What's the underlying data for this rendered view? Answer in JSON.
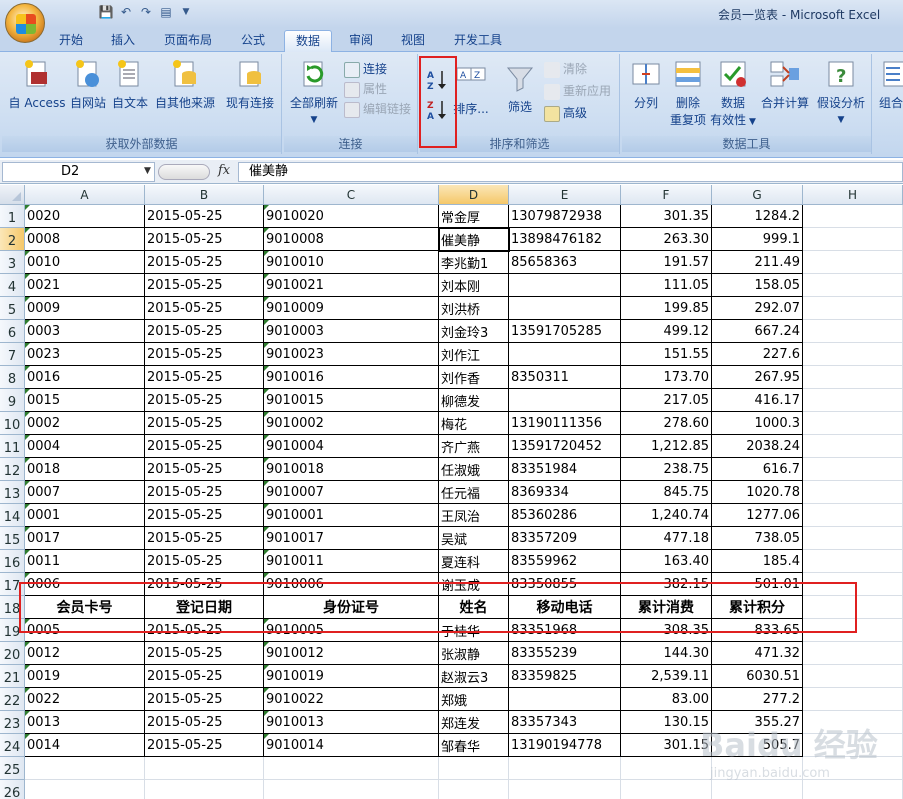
{
  "window": {
    "title": "会员一览表 - Microsoft Excel"
  },
  "tabs": [
    "开始",
    "插入",
    "页面布局",
    "公式",
    "数据",
    "审阅",
    "视图",
    "开发工具"
  ],
  "active_tab": "数据",
  "ribbon": {
    "group_external": {
      "label": "获取外部数据",
      "buttons": [
        "自 Access",
        "自网站",
        "自文本",
        "自其他来源",
        "现有连接"
      ]
    },
    "group_connections": {
      "label": "连接",
      "refresh": "全部刷新",
      "connections": "连接",
      "properties": "属性",
      "edit_links": "编辑链接"
    },
    "group_sort_filter": {
      "label": "排序和筛选",
      "sort": "排序...",
      "filter": "筛选",
      "clear": "清除",
      "reapply": "重新应用",
      "advanced": "高级"
    },
    "group_data_tools": {
      "label": "数据工具",
      "split": "分列",
      "remove_dup_1": "删除",
      "remove_dup_2": "重复项",
      "validation_1": "数据",
      "validation_2": "有效性",
      "consolidate": "合并计算",
      "whatif": "假设分析"
    },
    "group_outline": {
      "label": "组合"
    }
  },
  "formula_bar": {
    "name_box": "D2",
    "fx": "fx",
    "content": "催美静"
  },
  "columns": [
    "A",
    "B",
    "C",
    "D",
    "E",
    "F",
    "G",
    "H"
  ],
  "header_row": [
    "会员卡号",
    "登记日期",
    "身份证号",
    "姓名",
    "移动电话",
    "累计消费",
    "累计积分"
  ],
  "rows": [
    {
      "n": "1",
      "a": "0020",
      "b": "2015-05-25",
      "c": "9010020",
      "d": "常金厚",
      "e": "13079872938",
      "f": "301.35",
      "g": "1284.2"
    },
    {
      "n": "2",
      "a": "0008",
      "b": "2015-05-25",
      "c": "9010008",
      "d": "催美静",
      "e": "13898476182",
      "f": "263.30",
      "g": "999.1"
    },
    {
      "n": "3",
      "a": "0010",
      "b": "2015-05-25",
      "c": "9010010",
      "d": "李兆勤1",
      "e": "85658363",
      "f": "191.57",
      "g": "211.49"
    },
    {
      "n": "4",
      "a": "0021",
      "b": "2015-05-25",
      "c": "9010021",
      "d": "刘本刚",
      "e": "",
      "f": "111.05",
      "g": "158.05"
    },
    {
      "n": "5",
      "a": "0009",
      "b": "2015-05-25",
      "c": "9010009",
      "d": "刘洪桥",
      "e": "",
      "f": "199.85",
      "g": "292.07"
    },
    {
      "n": "6",
      "a": "0003",
      "b": "2015-05-25",
      "c": "9010003",
      "d": "刘金玲3",
      "e": "13591705285",
      "f": "499.12",
      "g": "667.24"
    },
    {
      "n": "7",
      "a": "0023",
      "b": "2015-05-25",
      "c": "9010023",
      "d": "刘作江",
      "e": "",
      "f": "151.55",
      "g": "227.6"
    },
    {
      "n": "8",
      "a": "0016",
      "b": "2015-05-25",
      "c": "9010016",
      "d": "刘作香",
      "e": "8350311",
      "f": "173.70",
      "g": "267.95"
    },
    {
      "n": "9",
      "a": "0015",
      "b": "2015-05-25",
      "c": "9010015",
      "d": "柳德发",
      "e": "",
      "f": "217.05",
      "g": "416.17"
    },
    {
      "n": "10",
      "a": "0002",
      "b": "2015-05-25",
      "c": "9010002",
      "d": "梅花",
      "e": "13190111356",
      "f": "278.60",
      "g": "1000.3"
    },
    {
      "n": "11",
      "a": "0004",
      "b": "2015-05-25",
      "c": "9010004",
      "d": "齐广燕",
      "e": "13591720452",
      "f": "1,212.85",
      "g": "2038.24"
    },
    {
      "n": "12",
      "a": "0018",
      "b": "2015-05-25",
      "c": "9010018",
      "d": "任淑娥",
      "e": "83351984",
      "f": "238.75",
      "g": "616.7"
    },
    {
      "n": "13",
      "a": "0007",
      "b": "2015-05-25",
      "c": "9010007",
      "d": "任元福",
      "e": "8369334",
      "f": "845.75",
      "g": "1020.78"
    },
    {
      "n": "14",
      "a": "0001",
      "b": "2015-05-25",
      "c": "9010001",
      "d": "王凤治",
      "e": "85360286",
      "f": "1,240.74",
      "g": "1277.06"
    },
    {
      "n": "15",
      "a": "0017",
      "b": "2015-05-25",
      "c": "9010017",
      "d": "吴斌",
      "e": "83357209",
      "f": "477.18",
      "g": "738.05"
    },
    {
      "n": "16",
      "a": "0011",
      "b": "2015-05-25",
      "c": "9010011",
      "d": "夏连科",
      "e": "83559962",
      "f": "163.40",
      "g": "185.4"
    },
    {
      "n": "17",
      "a": "0006",
      "b": "2015-05-25",
      "c": "9010006",
      "d": "谢玉成",
      "e": "83350855",
      "f": "382.15",
      "g": "501.01"
    },
    {
      "n": "18",
      "header": true
    },
    {
      "n": "19",
      "a": "0005",
      "b": "2015-05-25",
      "c": "9010005",
      "d": "于桂华",
      "e": "83351968",
      "f": "308.35",
      "g": "833.65"
    },
    {
      "n": "20",
      "a": "0012",
      "b": "2015-05-25",
      "c": "9010012",
      "d": "张淑静",
      "e": "83355239",
      "f": "144.30",
      "g": "471.32"
    },
    {
      "n": "21",
      "a": "0019",
      "b": "2015-05-25",
      "c": "9010019",
      "d": "赵淑云3",
      "e": "83359825",
      "f": "2,539.11",
      "g": "6030.51"
    },
    {
      "n": "22",
      "a": "0022",
      "b": "2015-05-25",
      "c": "9010022",
      "d": "郑娥",
      "e": "",
      "f": "83.00",
      "g": "277.2"
    },
    {
      "n": "23",
      "a": "0013",
      "b": "2015-05-25",
      "c": "9010013",
      "d": "郑连发",
      "e": "83357343",
      "f": "130.15",
      "g": "355.27"
    },
    {
      "n": "24",
      "a": "0014",
      "b": "2015-05-25",
      "c": "9010014",
      "d": "邹春华",
      "e": "13190194778",
      "f": "301.15",
      "g": "505.7"
    },
    {
      "n": "25",
      "empty": true
    },
    {
      "n": "26",
      "empty": true
    }
  ],
  "watermark": {
    "line1": "Baidu 经验",
    "line2": "jingyan.baidu.com"
  },
  "colors": {
    "highlight": "#e02020",
    "ribbon": "#cfdff2",
    "selection_header": "#f5c86a"
  }
}
